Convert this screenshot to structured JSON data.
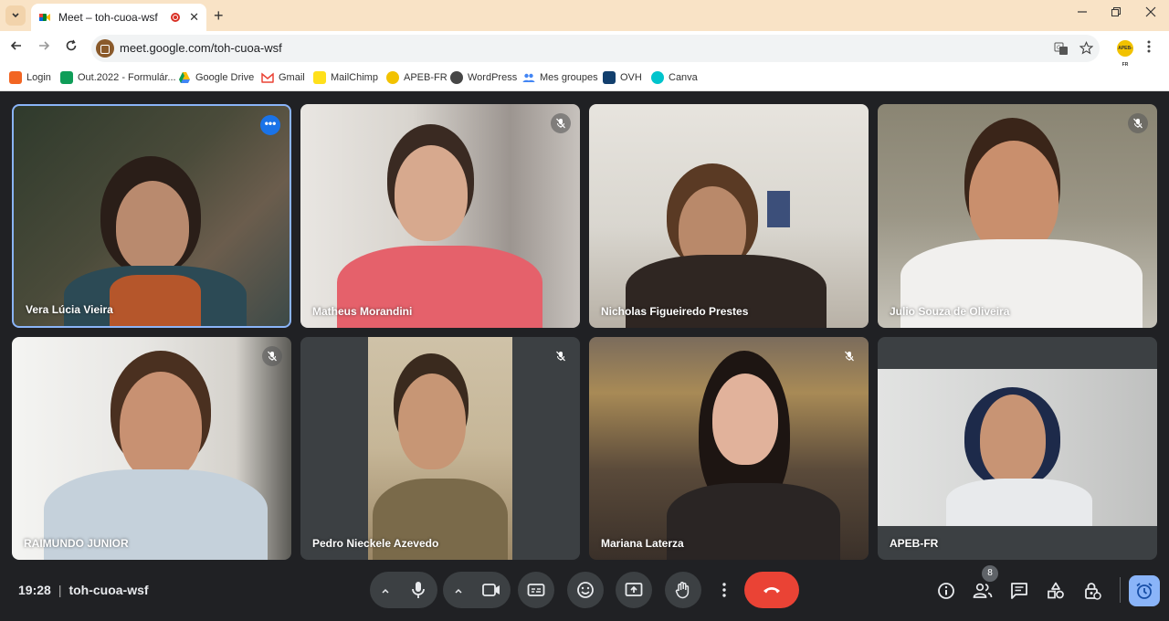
{
  "browser": {
    "tab_title": "Meet – toh-cuoa-wsf",
    "tab_close": "✕",
    "new_tab": "+",
    "url": "meet.google.com/toh-cuoa-wsf",
    "profile_badge": "APEB-FR",
    "window_controls": [
      "minimize-icon",
      "restore-icon",
      "close-icon"
    ]
  },
  "bookmarks": [
    {
      "label": "Login",
      "icon": "login-icon",
      "color": "#f26522"
    },
    {
      "label": "Out.2022 - Formulár...",
      "icon": "sheets-icon",
      "color": "#0f9d58"
    },
    {
      "label": "Google Drive",
      "icon": "drive-icon",
      "color": "#fbbc04"
    },
    {
      "label": "Gmail",
      "icon": "gmail-icon",
      "color": "#ea4335"
    },
    {
      "label": "MailChimp",
      "icon": "mailchimp-icon",
      "color": "#ffe01b"
    },
    {
      "label": "APEB-FR",
      "icon": "apeb-icon",
      "color": "#f2c200"
    },
    {
      "label": "WordPress",
      "icon": "wordpress-icon",
      "color": "#464646"
    },
    {
      "label": "Mes groupes",
      "icon": "groups-icon",
      "color": "#4285f4"
    },
    {
      "label": "OVH",
      "icon": "ovh-icon",
      "color": "#123f6d"
    },
    {
      "label": "Canva",
      "icon": "canva-icon",
      "color": "#00c4cc"
    }
  ],
  "participants": [
    {
      "name": "Vera Lúcia Vieira",
      "muted": false,
      "active_speaker": true
    },
    {
      "name": "Matheus Morandini",
      "muted": true
    },
    {
      "name": "Nicholas Figueiredo Prestes",
      "muted": false
    },
    {
      "name": "Julio Souza de Oliveira",
      "muted": true
    },
    {
      "name": "RAIMUNDO JUNIOR",
      "muted": true
    },
    {
      "name": "Pedro Nieckele Azevedo",
      "muted": true
    },
    {
      "name": "Mariana Laterza",
      "muted": true
    },
    {
      "name": "APEB-FR",
      "muted": false
    }
  ],
  "more_options_glyph": "•••",
  "meeting": {
    "time": "19:28",
    "separator": "|",
    "code": "toh-cuoa-wsf",
    "people_count": "8"
  },
  "colors": {
    "background": "#202124",
    "control": "#3c4043",
    "end_call": "#ea4335",
    "active_border": "#8ab4f8",
    "accent": "#1a73e8"
  }
}
